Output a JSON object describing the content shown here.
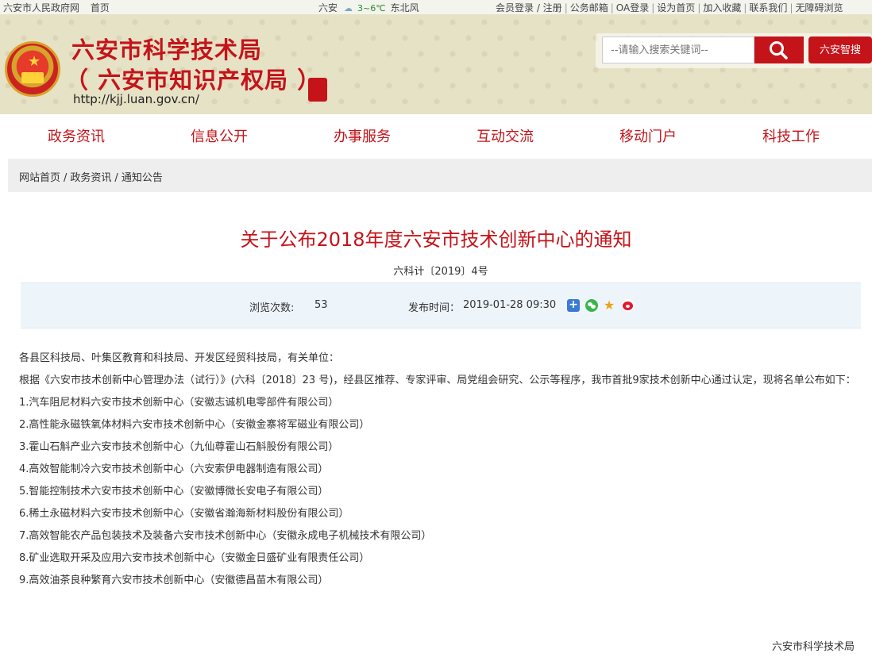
{
  "topbar": {
    "gov_link": "六安市人民政府网",
    "home_link": "首页",
    "city": "六安",
    "temperature": "3~6℃",
    "wind": "东北风",
    "links": [
      "会员登录 / 注册",
      "公务邮箱",
      "OA登录",
      "设为首页",
      "加入收藏",
      "联系我们",
      "无障碍浏览"
    ]
  },
  "header": {
    "title": "六安市科学技术局",
    "subtitle": "（ 六安市知识产权局 ）",
    "url": "http://kjj.luan.gov.cn/",
    "search_placeholder": "--请输入搜索关键词--",
    "smart_search_label": "六安智搜"
  },
  "nav": {
    "items": [
      "政务资讯",
      "信息公开",
      "办事服务",
      "互动交流",
      "移动门户",
      "科技工作"
    ]
  },
  "breadcrumb": {
    "items": [
      "网站首页",
      "政务资讯",
      "通知公告"
    ]
  },
  "article": {
    "title": "关于公布2018年度六安市技术创新中心的通知",
    "doc_number": "六科计〔2019〕4号",
    "views_label": "浏览次数:",
    "views": "53",
    "published_label": "发布时间：",
    "published": "2019-01-28 09:30",
    "salutation": "各县区科技局、叶集区教育和科技局、开发区经贸科技局，有关单位：",
    "intro": "根据《六安市技术创新中心管理办法（试行）》(六科〔2018〕23 号)，经县区推荐、专家评审、局党组会研究、公示等程序，我市首批9家技术创新中心通过认定，现将名单公布如下：",
    "list": [
      "1.汽车阻尼材料六安市技术创新中心（安徽志诚机电零部件有限公司）",
      "2.高性能永磁铁氧体材料六安市技术创新中心（安徽金寨将军磁业有限公司）",
      "3.霍山石斛产业六安市技术创新中心（九仙尊霍山石斛股份有限公司）",
      "4.高效智能制冷六安市技术创新中心（六安索伊电器制造有限公司）",
      "5.智能控制技术六安市技术创新中心（安徽博微长安电子有限公司）",
      "6.稀土永磁材料六安市技术创新中心（安徽省瀚海新材料股份有限公司）",
      "7.高效智能农产品包装技术及装备六安市技术创新中心（安徽永成电子机械技术有限公司）",
      "8.矿业选取开采及应用六安市技术创新中心（安徽金日盛矿业有限责任公司）",
      "9.高效油茶良种繁育六安市技术创新中心（安徽德昌苗木有限公司）"
    ],
    "signature": "六安市科学技术局"
  },
  "colors": {
    "brand_red": "#c4141a",
    "header_bg": "#e6e2c6",
    "infobar_bg": "#eef5fa"
  }
}
